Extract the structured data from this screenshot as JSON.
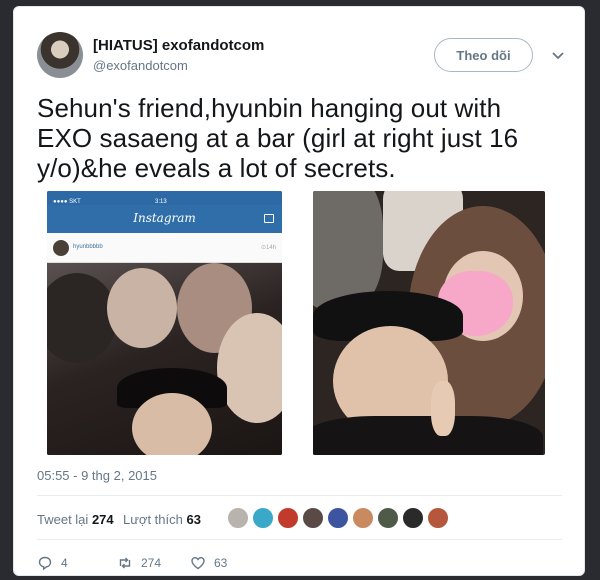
{
  "author": {
    "display_name": "[HIATUS] exofandotcom",
    "handle": "@exofandotcom",
    "follow_label": "Theo dõi"
  },
  "tweet": {
    "text": "Sehun's friend,hyunbin hanging out with EXO sasaeng at a bar (girl at right just 16 y/o)&he eveals a lot of secrets.",
    "timestamp": "05:55 - 9 thg 2, 2015"
  },
  "instagram": {
    "carrier": "●●●● SKT",
    "clock": "3:13",
    "logo": "Instagram",
    "username": "hyunbbbbb",
    "time_ago": "⊙14h"
  },
  "stats": {
    "retweets_label": "Tweet lại",
    "retweets_count": "274",
    "likes_label": "Lượt thích",
    "likes_count": "63"
  },
  "actions": {
    "reply_count": "4",
    "retweet_count": "274",
    "like_count": "63"
  },
  "icons": [
    "chevron-down-icon",
    "reply-icon",
    "retweet-icon",
    "heart-icon"
  ],
  "colors": {
    "text_primary": "#14171a",
    "text_secondary": "#657786",
    "instagram_blue": "#2f6ea8",
    "sticker_pink": "#f7a8c8"
  }
}
